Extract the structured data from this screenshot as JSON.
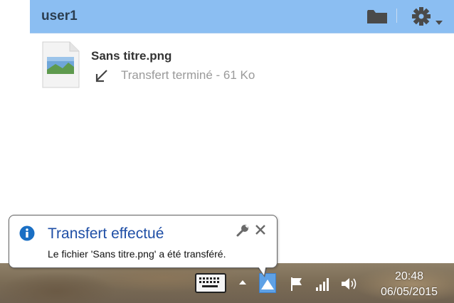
{
  "app": {
    "user_name": "user1",
    "icons": {
      "folder": "folder-icon",
      "settings": "gear-icon",
      "dropdown": "caret-down-icon"
    },
    "accent_color": "#8bbef2"
  },
  "files": [
    {
      "name": "Sans titre.png",
      "status": "Transfert terminé",
      "size": "61 Ko",
      "direction_icon": "download-arrow-icon"
    }
  ],
  "notification": {
    "title": "Transfert effectué",
    "message": "Le fichier 'Sans titre.png' a été transféré.",
    "icons": {
      "info": "info-icon",
      "settings": "wrench-icon",
      "close": "close-icon"
    }
  },
  "taskbar": {
    "time": "20:48",
    "date": "06/05/2015",
    "tray_icons": [
      "keyboard-icon",
      "chevron-up-icon",
      "pushbullet-icon",
      "flag-icon",
      "signal-icon",
      "volume-icon"
    ]
  }
}
